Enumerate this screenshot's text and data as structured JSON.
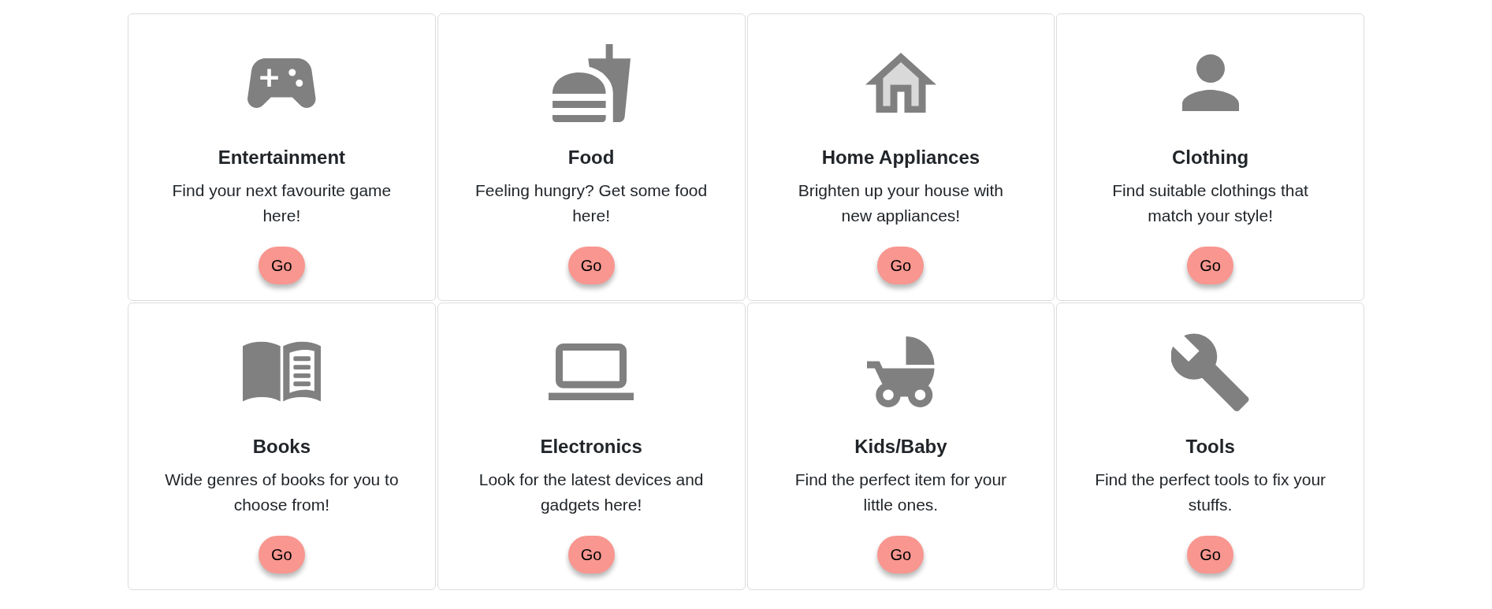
{
  "categories": [
    {
      "title": "Entertainment",
      "description": "Find your next favourite game here!",
      "button": "Go"
    },
    {
      "title": "Food",
      "description": "Feeling hungry? Get some food here!",
      "button": "Go"
    },
    {
      "title": "Home Appliances",
      "description": "Brighten up your house with new appliances!",
      "button": "Go"
    },
    {
      "title": "Clothing",
      "description": "Find suitable clothings that match your style!",
      "button": "Go"
    },
    {
      "title": "Books",
      "description": "Wide genres of books for you to choose from!",
      "button": "Go"
    },
    {
      "title": "Electronics",
      "description": "Look for the latest devices and gadgets here!",
      "button": "Go"
    },
    {
      "title": "Kids/Baby",
      "description": "Find the perfect item for your little ones.",
      "button": "Go"
    },
    {
      "title": "Tools",
      "description": "Find the perfect tools to fix your stuffs.",
      "button": "Go"
    }
  ]
}
